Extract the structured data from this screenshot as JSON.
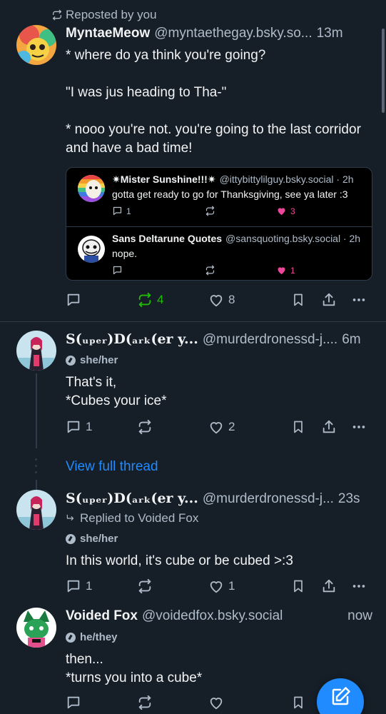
{
  "colors": {
    "background": "#161e27",
    "accent": "#208bfe",
    "repost_green": "#20bc07",
    "like_pink": "#ec4899",
    "muted": "#aebbc9"
  },
  "post1": {
    "repost_label": "Reposted by you",
    "author_name": "MyntaeMeow",
    "author_handle": "@myntaethegay.bsky.so...",
    "time": "13m",
    "text": "* where do ya think you're going?\n\n\"I was jus heading to Tha-\"\n\n* nooo you're not. you're going to the last corridor and have a bad time!",
    "quote1": {
      "name": "✷Mister Sunshine!!!✷",
      "handle": "@ittybittylilguy.bsky.social · 2h",
      "text": "gotta get ready to go for Thanksgiving, see ya later :3",
      "replies": "1",
      "likes": "3"
    },
    "quote2": {
      "name": "Sans Deltarune Quotes",
      "handle": "@sansquoting.bsky.social · 2h",
      "text": "nope.",
      "likes": "1"
    },
    "reposts": "4",
    "likes": "8"
  },
  "post2": {
    "author_name": "S(ᵤₚₑᵣ)D(ₐᵣₖ(er y...",
    "author_handle": "@murderdronessd-j....",
    "time": "6m",
    "pronouns": "she/her",
    "text": "That's it,\n*Cubes your ice*",
    "replies": "1",
    "likes": "2"
  },
  "view_full_thread": "View full thread",
  "post3": {
    "author_name": "S(ᵤₚₑᵣ)D(ₐᵣₖ(er y...",
    "author_handle": "@murderdronessd-j...",
    "time": "23s",
    "replied_to": "Replied to Voided Fox",
    "pronouns": "she/her",
    "text": "In this world, it's cube or be cubed >:3",
    "replies": "1",
    "likes": "1"
  },
  "post4": {
    "author_name": "Voided Fox",
    "author_handle": "@voidedfox.bsky.social",
    "time": "now",
    "pronouns": "he/they",
    "text": "then...\n*turns you into a cube*"
  },
  "icons": [
    "repost-icon",
    "reply-icon",
    "heart-icon",
    "bookmark-icon",
    "share-icon",
    "more-icon",
    "compose-icon"
  ]
}
